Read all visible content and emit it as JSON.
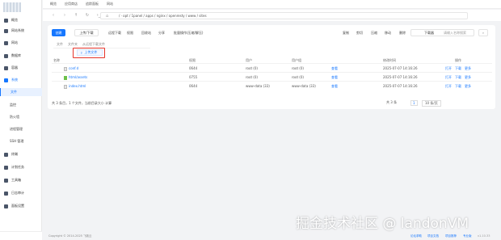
{
  "topbar": {
    "items": [
      "概览",
      "应用商店",
      "追踪面板",
      "网站"
    ]
  },
  "nav": {
    "path": "/ · opt / 1panel / apps / nginx / openresty / www / sites"
  },
  "sidebar": {
    "items": [
      {
        "label": "概览",
        "top": 0
      },
      {
        "label": "网站系统",
        "top": 0
      },
      {
        "label": "网站",
        "top": 0
      },
      {
        "label": "数据库",
        "top": 0
      },
      {
        "label": "容器",
        "top": 0
      },
      {
        "label": "系统",
        "top": 0
      }
    ],
    "sub": [
      "文件",
      "监控",
      "防火墙",
      "进程管理",
      "SSH 管理"
    ],
    "bottom": [
      "终端",
      "计划任务",
      "工具箱",
      "日志审计",
      "面板设置"
    ]
  },
  "toolbar": {
    "create": "创建",
    "upload": "上传/下载",
    "tools": [
      "远程下载",
      "权限",
      "回收站",
      "分享",
      "批量操作(压缩/解压)"
    ],
    "right": [
      "复制",
      "剪切",
      "压缩",
      "移动",
      "删除"
    ],
    "download": "下载器",
    "search_placeholder": "请输入名称搜索"
  },
  "dropdown": {
    "items": [
      "文件",
      "文件夹",
      "从远程下载文件"
    ]
  },
  "upload_btn": "上传文件",
  "table": {
    "headers": [
      "名称",
      "权限",
      "用户",
      "用户组",
      "修改时间",
      "操作"
    ],
    "rows": [
      {
        "name": "conf.d",
        "perm": "0644",
        "user": "root (0)",
        "group": "root (0)",
        "mtime": "2025-07-07 14:16:26",
        "ops": [
          "打开",
          "下载",
          "更多"
        ]
      },
      {
        "name": "html/assets",
        "perm": "0755",
        "user": "root (0)",
        "group": "root (0)",
        "mtime": "2025-07-07 14:16:26",
        "ops": [
          "打开",
          "下载",
          "更多"
        ]
      },
      {
        "name": "index.html",
        "perm": "0644",
        "user": "www-data (33)",
        "group": "www-data (33)",
        "mtime": "2025-07-07 14:16:26",
        "ops": [
          "打开",
          "下载",
          "更多"
        ]
      }
    ],
    "group_link": "查看"
  },
  "footer": {
    "summary": "共 3 条目，1 个文件，当前目录大小 计算",
    "pager": [
      "共 3 条",
      "1",
      "10 条/页"
    ]
  },
  "copyright": "Copyright © 2014-2025 飞致云",
  "footlinks": [
    "论坛求助",
    "项目文档",
    "项目推荐",
    "专业版",
    "v1.10.33"
  ],
  "watermark": "掘金技术社区 @ landonVM",
  "colors": {
    "accent": "#1677ff",
    "highlight": "#e5332a"
  }
}
